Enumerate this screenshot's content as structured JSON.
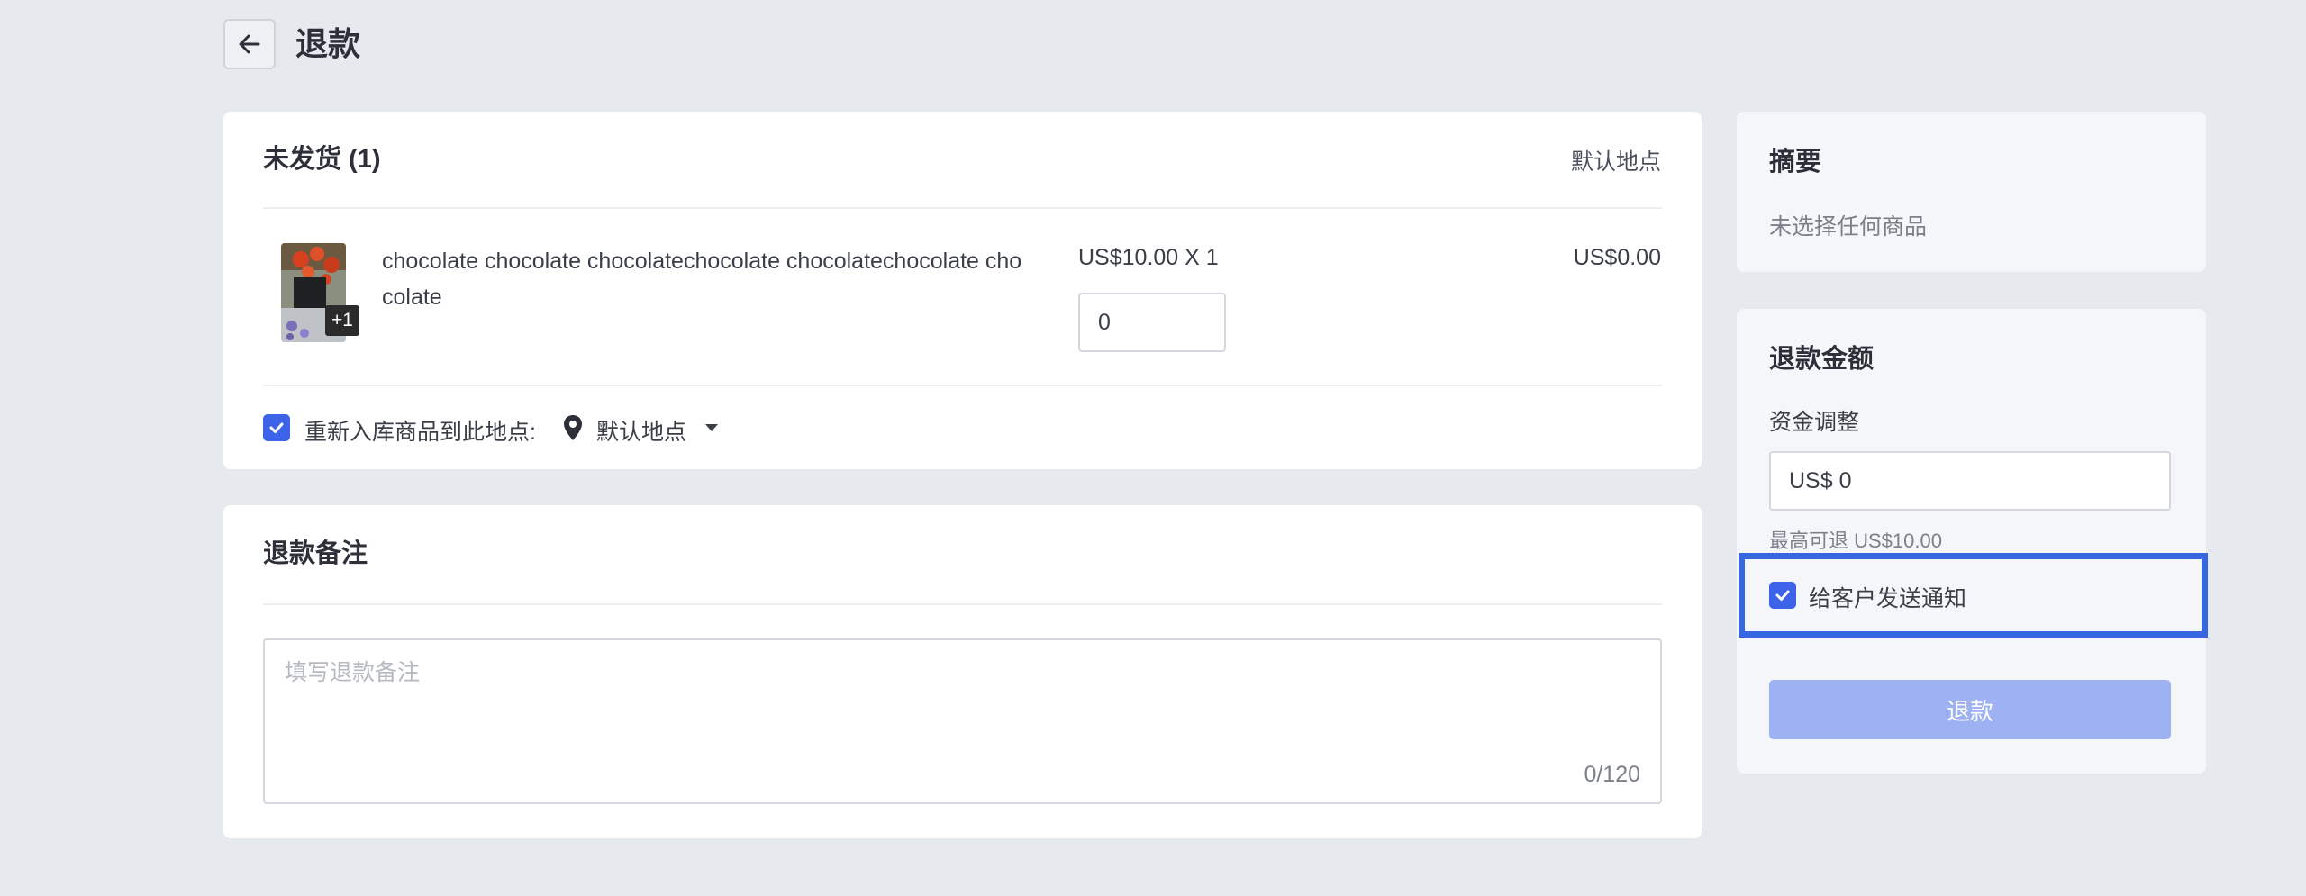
{
  "header": {
    "back_icon": "arrow-left-icon",
    "title": "退款"
  },
  "unshipped": {
    "title": "未发货 (1)",
    "location": "默认地点",
    "item": {
      "name": "chocolate chocolate chocolatechocolate chocolatechocolate chocolate",
      "thumb_badge": "+1",
      "unit_price": "US$10.00 X 1",
      "quantity": "0",
      "line_total": "US$0.00"
    },
    "restock": {
      "checked": true,
      "label": "重新入库商品到此地点:",
      "location": "默认地点"
    }
  },
  "notes": {
    "title": "退款备注",
    "placeholder": "填写退款备注",
    "counter": "0/120"
  },
  "summary": {
    "title": "摘要",
    "empty_text": "未选择任何商品"
  },
  "refund": {
    "title": "退款金额",
    "adjust_label": "资金调整",
    "amount_value": "US$ 0",
    "max_refund": "最高可退 US$10.00",
    "notify_checked": true,
    "notify_label": "给客户发送通知",
    "button_label": "退款"
  },
  "colors": {
    "accent": "#3d63e8",
    "button_disabled": "#9db1f3",
    "background": "#e6e9ee",
    "highlight": "#3667e0"
  }
}
